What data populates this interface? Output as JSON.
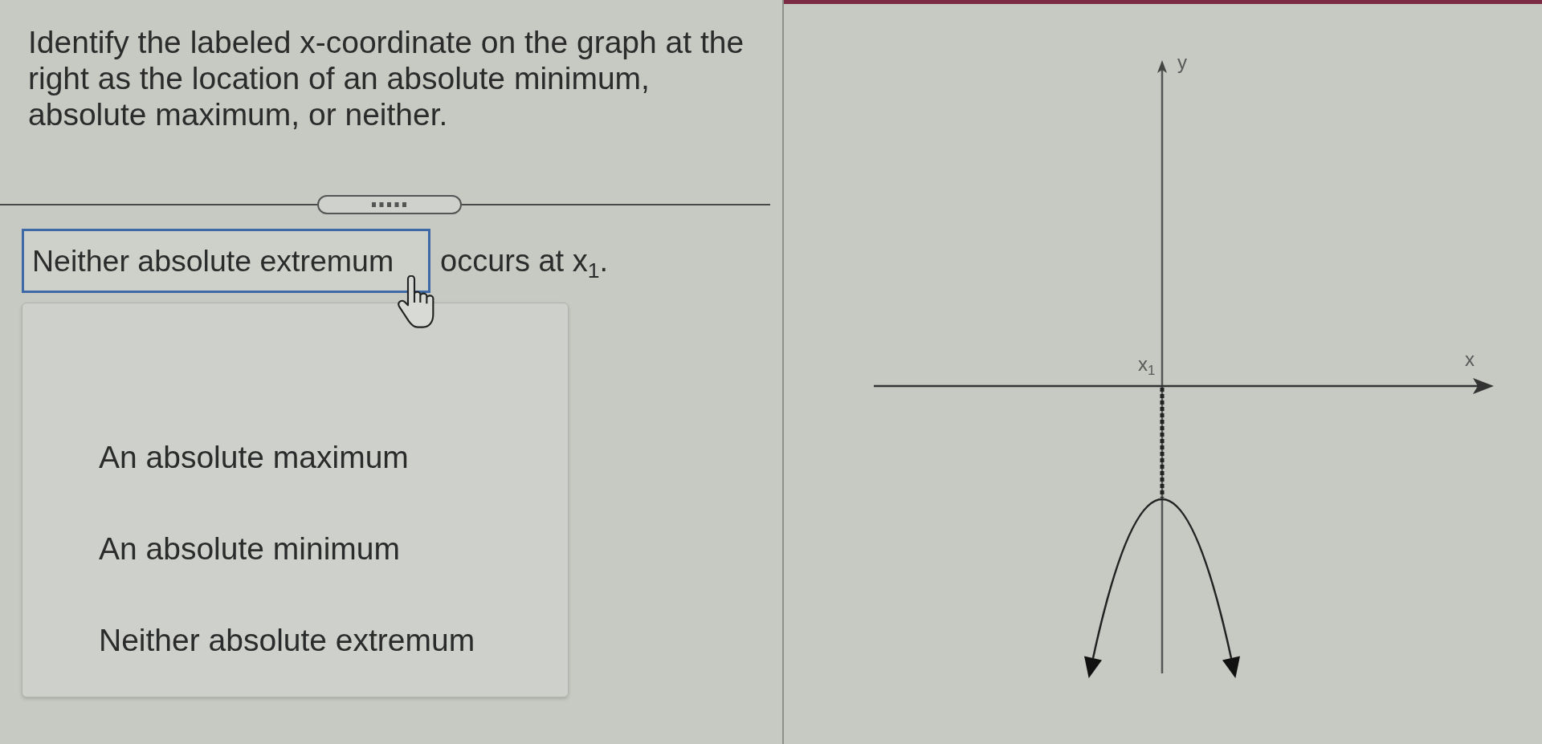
{
  "question": {
    "text": "Identify the labeled x-coordinate on the graph at the right as the location of an absolute minimum, absolute maximum, or neither."
  },
  "answer": {
    "dropdown": {
      "value": "Neither absolute extremum",
      "expanded": true
    },
    "suffix": "occurs at x$_{1}$."
  },
  "dropdown_options": [
    {
      "label": "An absolute maximum",
      "selected": false
    },
    {
      "label": "An absolute minimum",
      "selected": false
    },
    {
      "label": "Neither absolute extremum",
      "selected": false
    }
  ],
  "graph": {
    "y_label": "y",
    "x_label": "x",
    "point_label": "x$_{1}$"
  }
}
